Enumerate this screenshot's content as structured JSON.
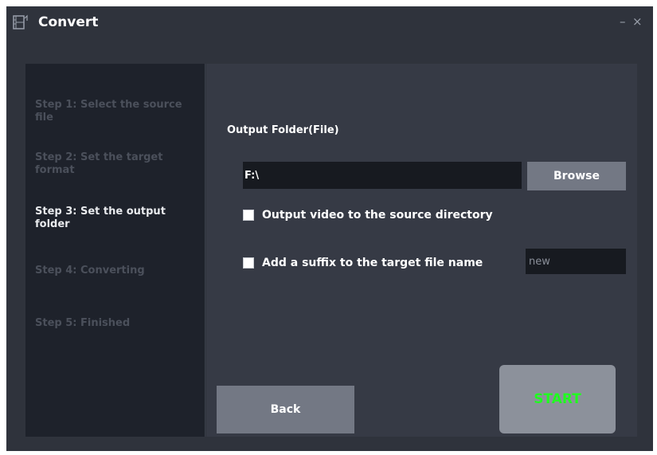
{
  "window": {
    "title": "Convert",
    "icon": "film-strip-icon",
    "minimize_label": "–",
    "close_label": "×"
  },
  "sidebar": {
    "steps": [
      {
        "label": "Step 1: Select the source file",
        "active": false
      },
      {
        "label": "Step 2: Set the target format",
        "active": false
      },
      {
        "label": "Step 3: Set the output folder",
        "active": true
      },
      {
        "label": "Step 4: Converting",
        "active": false
      },
      {
        "label": "Step 5: Finished",
        "active": false
      }
    ]
  },
  "main": {
    "section_label": "Output Folder(File)",
    "output_path": "F:\\",
    "browse_label": "Browse",
    "options": [
      {
        "label": "Output video to the source directory",
        "checked": false
      },
      {
        "label": "Add a suffix to the target file name",
        "checked": false
      }
    ],
    "suffix_value": "new",
    "back_label": "Back",
    "start_label": "START"
  },
  "colors": {
    "window_bg": "#2f333c",
    "sidebar_bg": "#1e222b",
    "content_bg": "#363a45",
    "button_bg": "#737884",
    "start_text": "#1fff1f"
  }
}
